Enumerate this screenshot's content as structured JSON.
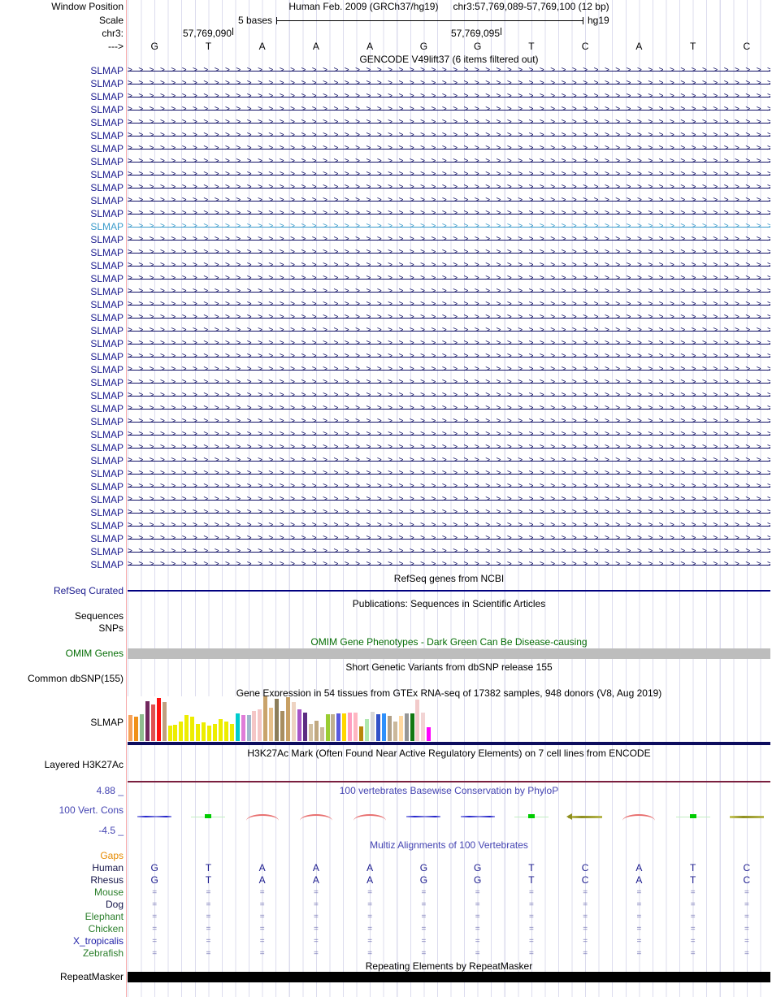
{
  "header": {
    "window_position_label": "Window Position",
    "assembly": "Human Feb. 2009 (GRCh37/hg19)",
    "position": "chr3:57,769,089-57,769,100 (12 bp)",
    "scale_label": "Scale",
    "scale_value": "5 bases",
    "genome": "hg19",
    "chrom_label": "chr3:",
    "coord_left": "57,769,090",
    "coord_right": "57,769,095",
    "strand_label": "--->",
    "bases": [
      "G",
      "T",
      "A",
      "A",
      "A",
      "G",
      "G",
      "T",
      "C",
      "A",
      "T",
      "C"
    ]
  },
  "gencode": {
    "title": "GENCODE V49lift37 (6 items filtered out)",
    "gene_label": "SLMAP",
    "row_count": 39,
    "highlight_index": 12,
    "label_color": "#1B1B8E",
    "arrow_color": "#101065",
    "highlight_color": "#3B9BCB"
  },
  "refseq": {
    "title": "RefSeq genes from NCBI",
    "label": "RefSeq Curated"
  },
  "publications": {
    "title": "Publications: Sequences in Scientific Articles",
    "sequences_label": "Sequences",
    "snps_label": "SNPs"
  },
  "omim": {
    "title": "OMIM Gene Phenotypes - Dark Green Can Be Disease-causing",
    "label": "OMIM Genes"
  },
  "dbsnp": {
    "title": "Short Genetic Variants from dbSNP release 155",
    "label": "Common dbSNP(155)"
  },
  "gtex": {
    "title": "Gene Expression in 54 tissues from GTEx RNA-seq of 17382 samples, 948 donors (V8, Aug 2019)",
    "label": "SLMAP"
  },
  "h3k27ac": {
    "title": "H3K27Ac Mark (Often Found Near Active Regulatory Elements) on 7 cell lines from ENCODE",
    "label": "Layered H3K27Ac"
  },
  "conservation": {
    "title": "100 vertebrates Basewise Conservation by PhyloP",
    "label": "100 Vert. Cons",
    "max_label": "4.88 _",
    "min_label": "-4.5 _",
    "marks": [
      "blue-line",
      "green-dot",
      "red-arc",
      "red-arc",
      "red-arc",
      "blue-line",
      "blue-line",
      "green-dot",
      "olive-arrow",
      "red-arc",
      "green-dot",
      "olive-line"
    ]
  },
  "multiz": {
    "title": "Multiz Alignments of 100 Vertebrates",
    "rows": [
      {
        "label": "Gaps",
        "label_color": "#E68A00",
        "cell_type": "none",
        "cells": []
      },
      {
        "label": "Human",
        "label_color": "#15154A",
        "cell_type": "base",
        "cells": [
          "G",
          "T",
          "A",
          "A",
          "A",
          "G",
          "G",
          "T",
          "C",
          "A",
          "T",
          "C"
        ]
      },
      {
        "label": "Rhesus",
        "label_color": "#15154A",
        "cell_type": "base",
        "cells": [
          "G",
          "T",
          "A",
          "A",
          "A",
          "G",
          "G",
          "T",
          "C",
          "A",
          "T",
          "C"
        ]
      },
      {
        "label": "Mouse",
        "label_color": "#2A7E2A",
        "cell_type": "eq",
        "cells": [
          "=",
          "=",
          "=",
          "=",
          "=",
          "=",
          "=",
          "=",
          "=",
          "=",
          "=",
          "="
        ]
      },
      {
        "label": "Dog",
        "label_color": "#15154A",
        "cell_type": "eq",
        "cells": [
          "=",
          "=",
          "=",
          "=",
          "=",
          "=",
          "=",
          "=",
          "=",
          "=",
          "=",
          "="
        ]
      },
      {
        "label": "Elephant",
        "label_color": "#2A7E2A",
        "cell_type": "eq",
        "cells": [
          "=",
          "=",
          "=",
          "=",
          "=",
          "=",
          "=",
          "=",
          "=",
          "=",
          "=",
          "="
        ]
      },
      {
        "label": "Chicken",
        "label_color": "#2A7E2A",
        "cell_type": "eq",
        "cells": [
          "=",
          "=",
          "=",
          "=",
          "=",
          "=",
          "=",
          "=",
          "=",
          "=",
          "=",
          "="
        ]
      },
      {
        "label": "X_tropicalis",
        "label_color": "#2222A8",
        "cell_type": "eq",
        "cells": [
          "=",
          "=",
          "=",
          "=",
          "=",
          "=",
          "=",
          "=",
          "=",
          "=",
          "=",
          "="
        ]
      },
      {
        "label": "Zebrafish",
        "label_color": "#2A7E2A",
        "cell_type": "eq",
        "cells": [
          "=",
          "=",
          "=",
          "=",
          "=",
          "=",
          "=",
          "=",
          "=",
          "=",
          "=",
          "="
        ]
      }
    ]
  },
  "repeatmasker": {
    "title": "Repeating Elements by RepeatMasker",
    "label": "RepeatMasker"
  },
  "chart_data": {
    "type": "bar",
    "title": "Gene Expression in 54 tissues from GTEx RNA-seq of 17382 samples, 948 donors (V8, Aug 2019)",
    "gene": "SLMAP",
    "ylabel": "",
    "xlabel": "",
    "n_bars": 54,
    "values_rel": [
      0.58,
      0.55,
      0.6,
      0.89,
      0.82,
      0.96,
      0.87,
      0.35,
      0.37,
      0.44,
      0.58,
      0.55,
      0.38,
      0.42,
      0.35,
      0.38,
      0.49,
      0.44,
      0.38,
      0.62,
      0.58,
      0.58,
      0.68,
      0.7,
      1.0,
      0.75,
      0.95,
      0.68,
      0.98,
      0.88,
      0.7,
      0.64,
      0.38,
      0.46,
      0.31,
      0.6,
      0.6,
      0.62,
      0.62,
      0.64,
      0.64,
      0.33,
      0.49,
      0.66,
      0.6,
      0.62,
      0.56,
      0.44,
      0.56,
      0.62,
      0.62,
      0.93,
      0.64,
      0.31
    ],
    "colors": [
      "#F5A25A",
      "#F09018",
      "#8FBC8F",
      "#72275E",
      "#E05050",
      "#FF1010",
      "#C0A080",
      "#EDED00",
      "#EDED00",
      "#EDED00",
      "#EDED00",
      "#EDED00",
      "#EDED00",
      "#EDED00",
      "#EDED00",
      "#EDED00",
      "#EDED00",
      "#EDED00",
      "#EDED00",
      "#00CCCC",
      "#E07CD8",
      "#9FB6CD",
      "#F4C6C6",
      "#F4C6C6",
      "#C9A36B",
      "#E6C08A",
      "#8B7D5A",
      "#A88E60",
      "#C8A064",
      "#EED3C1",
      "#A855C8",
      "#5C2D82",
      "#D2C0A0",
      "#C0A880",
      "#CBBB9C",
      "#9ACD32",
      "#C0B090",
      "#5A5ADF",
      "#FFD700",
      "#FF9EC0",
      "#FFB6C1",
      "#B8860B",
      "#AEE8AE",
      "#D8D8D8",
      "#3252C8",
      "#2E90FA",
      "#B0A088",
      "#CBB89B",
      "#FFD8A0",
      "#969696",
      "#117711",
      "#F2CACA",
      "#F2D4D4",
      "#FF00FF"
    ]
  }
}
